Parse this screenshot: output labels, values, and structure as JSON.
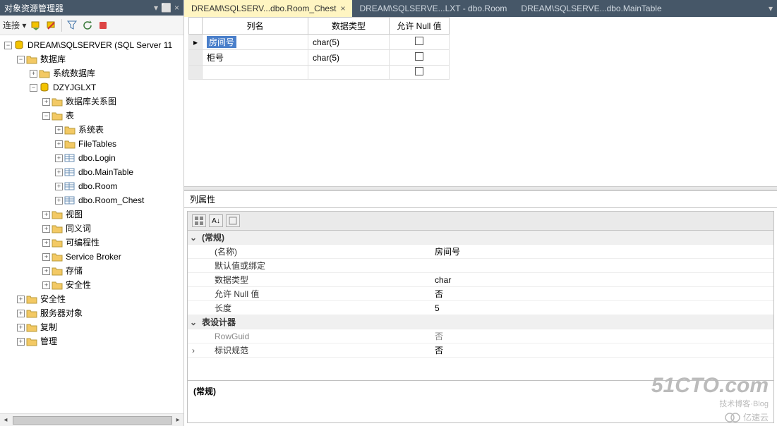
{
  "panel": {
    "title": "对象资源管理器",
    "pin_symbol": "▾ ⏸",
    "close_symbol": "×"
  },
  "toolbar": {
    "connect": "连接 ▾"
  },
  "tree": {
    "server": "DREAM\\SQLSERVER (SQL Server 11",
    "databases": "数据库",
    "sysdb": "系统数据库",
    "userdb": "DZYJGLXT",
    "diagrams": "数据库关系图",
    "tables": "表",
    "systables": "系统表",
    "filetables": "FileTables",
    "t_login": "dbo.Login",
    "t_main": "dbo.MainTable",
    "t_room": "dbo.Room",
    "t_chest": "dbo.Room_Chest",
    "views": "视图",
    "synonyms": "同义词",
    "programmability": "可编程性",
    "servicebroker": "Service Broker",
    "storage": "存储",
    "security_db": "安全性",
    "security": "安全性",
    "serverobj": "服务器对象",
    "replication": "复制",
    "management": "管理"
  },
  "tabs": {
    "t1": "DREAM\\SQLSERV...dbo.Room_Chest",
    "t1_close": "×",
    "t2": "DREAM\\SQLSERVE...LXT - dbo.Room",
    "t3": "DREAM\\SQLSERVE...dbo.MainTable",
    "overflow": "▾"
  },
  "grid": {
    "h_name": "列名",
    "h_type": "数据类型",
    "h_null": "允许 Null 值",
    "r1_name": "房间号",
    "r1_type": "char(5)",
    "r2_name": "柜号",
    "r2_type": "char(5)",
    "pointer": "▸"
  },
  "props": {
    "title": "列属性",
    "cat_general": "(常规)",
    "name_l": "(名称)",
    "name_v": "房间号",
    "default_l": "默认值或绑定",
    "default_v": "",
    "type_l": "数据类型",
    "type_v": "char",
    "null_l": "允许 Null 值",
    "null_v": "否",
    "len_l": "长度",
    "len_v": "5",
    "cat_designer": "表设计器",
    "rowguid_l": "RowGuid",
    "rowguid_v": "否",
    "identity_l": "标识规范",
    "identity_v": "否",
    "desc_title": "(常规)"
  },
  "watermarks": {
    "w1": "51CTO.com",
    "w1b": "技术博客·Blog",
    "w2": "亿速云"
  }
}
